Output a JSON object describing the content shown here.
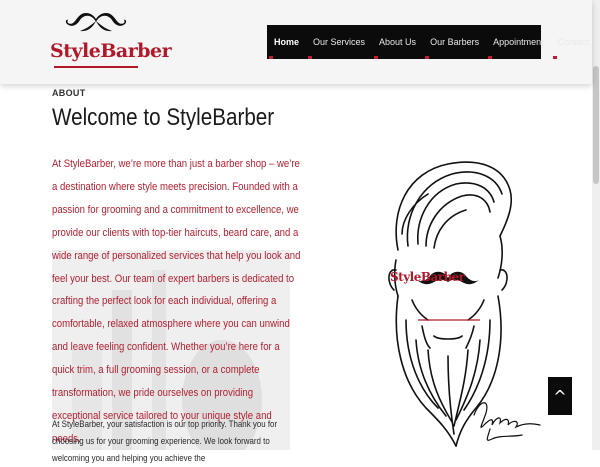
{
  "brand": {
    "logo_text": "StyleBarber"
  },
  "nav": {
    "items": [
      {
        "label": "Home",
        "active": true
      },
      {
        "label": "Our Services",
        "active": false
      },
      {
        "label": "About Us",
        "active": false
      },
      {
        "label": "Our Barbers",
        "active": false
      },
      {
        "label": "Appointment",
        "active": false
      },
      {
        "label": "Contact",
        "active": false
      }
    ]
  },
  "about": {
    "section_label": "ABOUT",
    "title": "Welcome to StyleBarber",
    "intro": "At StyleBarber, we’re more than just a barber shop – we’re a destination where style meets precision. Founded with a passion for grooming and a commitment to excellence, we provide our clients with top-tier haircuts, beard care, and a wide range of personalized services that help you look and feel your best. Our team of expert barbers is dedicated to crafting the perfect look for each individual, offering a comfortable, relaxed atmosphere where you can unwind and leave feeling confident. Whether you’re here for a quick trim, a full grooming session, or a complete transformation, we pride ourselves on providing exceptional service tailored to your unique style and needs.",
    "paragraph2": "At StyleBarber, your satisfaction is our top priority. Thank you for choosing us for your grooming experience. We look forward to welcoming you and helping you achieve the"
  },
  "illustration": {
    "logo_text": "StyleBarber"
  },
  "scroll_top": {
    "icon": "chevron-up-icon",
    "glyph": "^"
  },
  "colors": {
    "accent": "#b0192a",
    "nav_bg": "#0b0b0b",
    "header_bg": "#f5f5f6"
  }
}
